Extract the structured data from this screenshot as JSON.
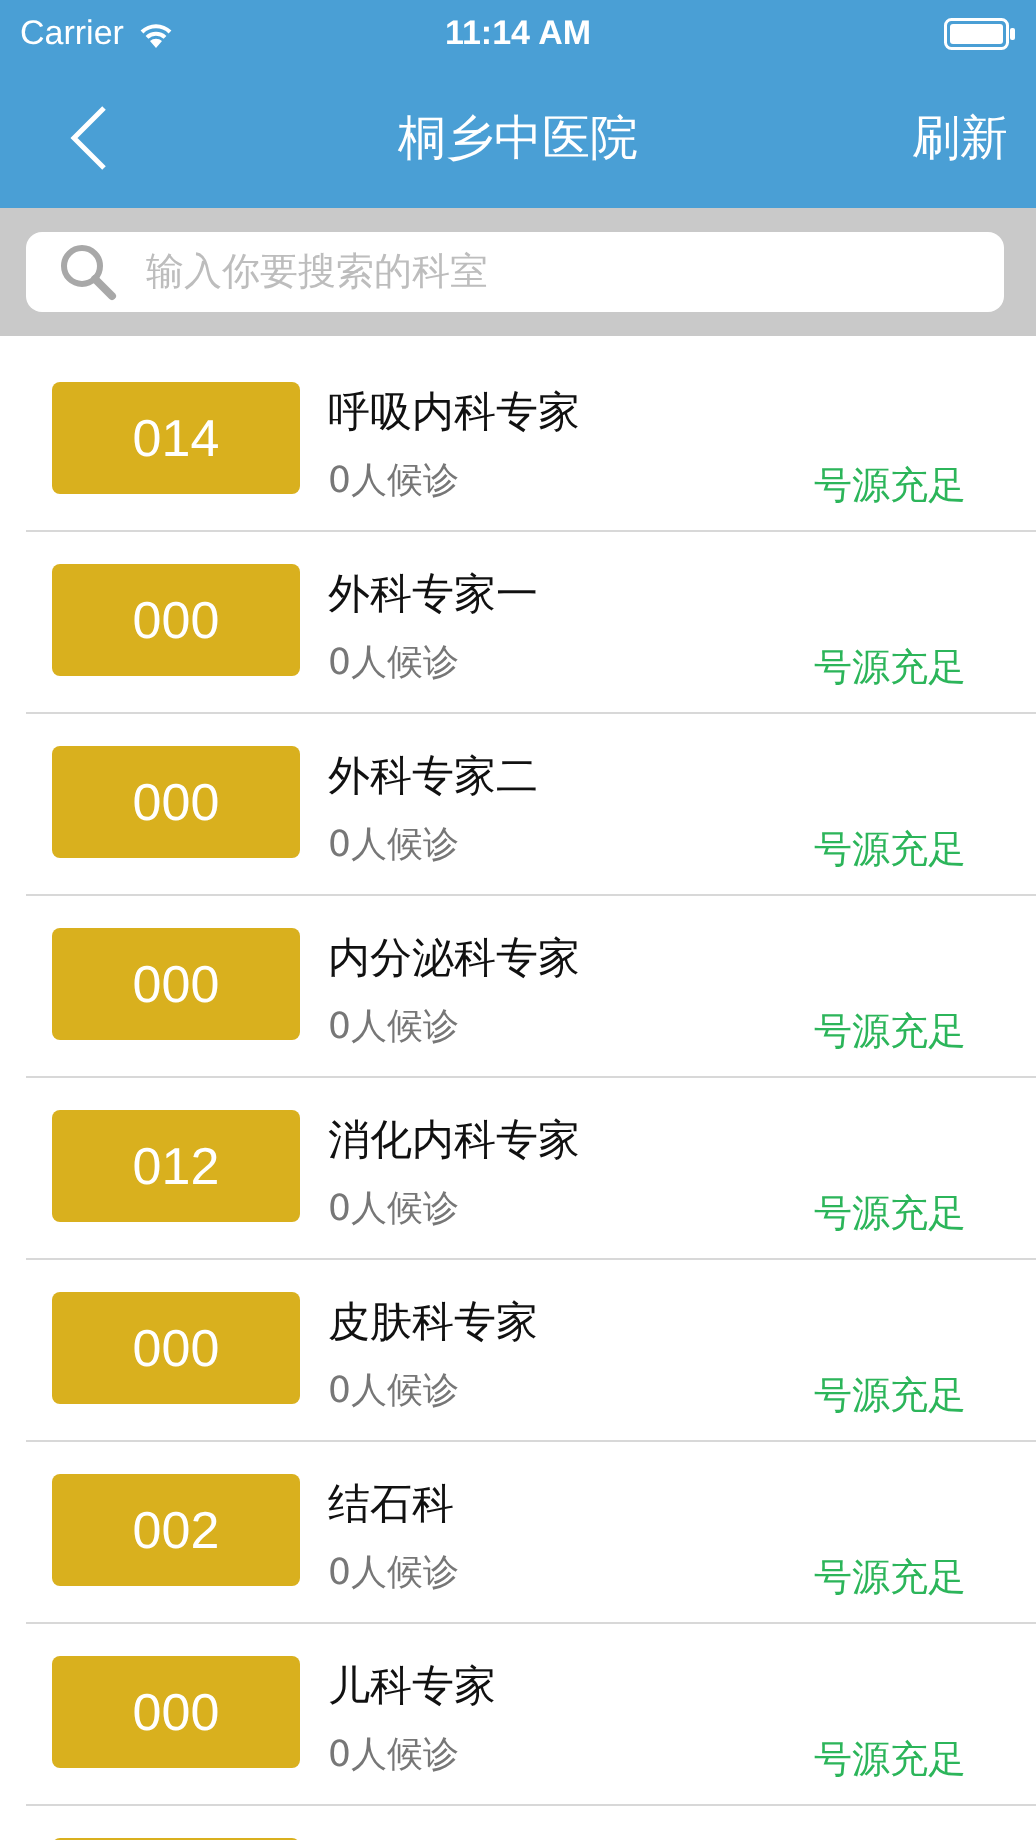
{
  "status_bar": {
    "carrier": "Carrier",
    "time": "11:14 AM"
  },
  "nav": {
    "title": "桐乡中医院",
    "action": "刷新"
  },
  "search": {
    "placeholder": "输入你要搜索的科室"
  },
  "rows": [
    {
      "kind": "full",
      "number": "014",
      "name": "呼吸内科专家",
      "waiting": "0人候诊",
      "status": "号源充足"
    },
    {
      "kind": "full",
      "number": "000",
      "name": "外科专家一",
      "waiting": "0人候诊",
      "status": "号源充足"
    },
    {
      "kind": "full",
      "number": "000",
      "name": "外科专家二",
      "waiting": "0人候诊",
      "status": "号源充足"
    },
    {
      "kind": "full",
      "number": "000",
      "name": "内分泌科专家",
      "waiting": "0人候诊",
      "status": "号源充足"
    },
    {
      "kind": "full",
      "number": "012",
      "name": "消化内科专家",
      "waiting": "0人候诊",
      "status": "号源充足"
    },
    {
      "kind": "full",
      "number": "000",
      "name": "皮肤科专家",
      "waiting": "0人候诊",
      "status": "号源充足"
    },
    {
      "kind": "full",
      "number": "002",
      "name": "结石科",
      "waiting": "0人候诊",
      "status": "号源充足"
    },
    {
      "kind": "full",
      "number": "000",
      "name": "儿科专家",
      "waiting": "0人候诊",
      "status": "号源充足"
    },
    {
      "kind": "partial"
    }
  ]
}
